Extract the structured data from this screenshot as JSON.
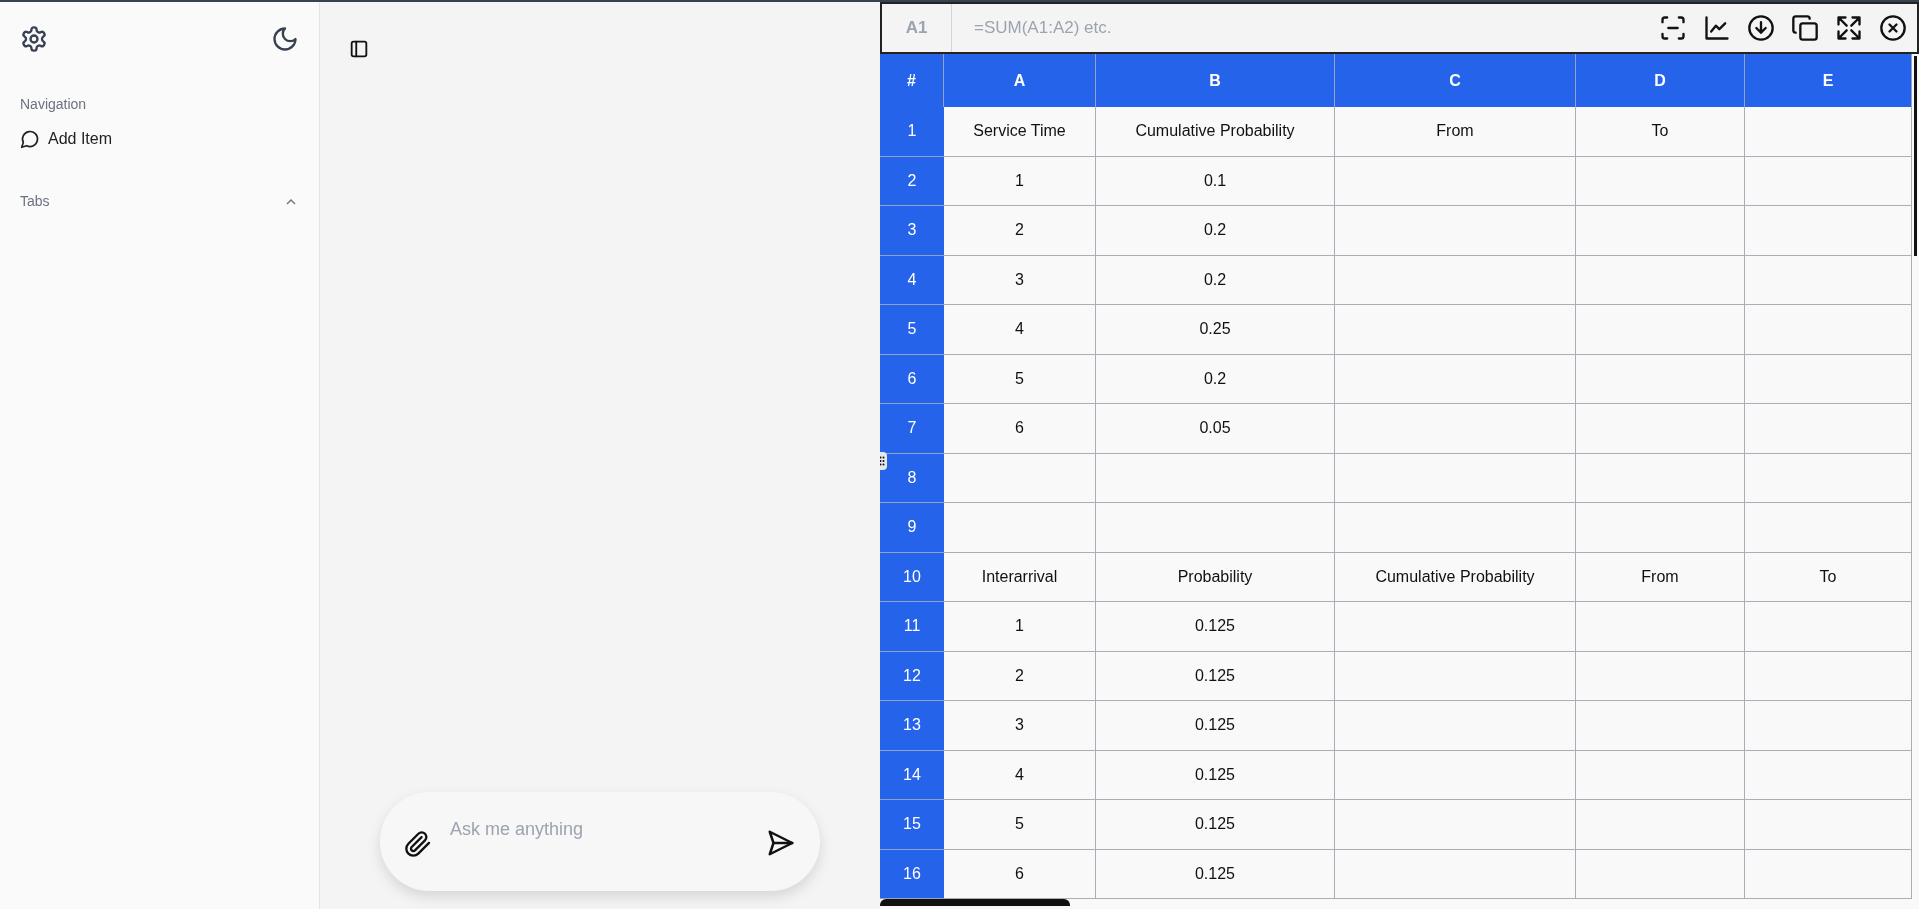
{
  "sidebar": {
    "navigation_heading": "Navigation",
    "items": [
      {
        "label": "Add Item"
      }
    ],
    "tabs_section": {
      "label": "Tabs",
      "expanded": true
    }
  },
  "chat": {
    "placeholder": "Ask me anything"
  },
  "spreadsheet": {
    "cell_reference": "A1",
    "formula_placeholder": "=SUM(A1:A2) etc.",
    "corner": "#",
    "columns": [
      "A",
      "B",
      "C",
      "D",
      "E"
    ],
    "rows": [
      {
        "number": "1",
        "cells": [
          "Service Time",
          "Cumulative Probability",
          "From",
          "To",
          null
        ]
      },
      {
        "number": "2",
        "cells": [
          "1",
          "0.1",
          null,
          null,
          null
        ]
      },
      {
        "number": "3",
        "cells": [
          "2",
          "0.2",
          null,
          null,
          null
        ]
      },
      {
        "number": "4",
        "cells": [
          "3",
          "0.2",
          null,
          null,
          null
        ]
      },
      {
        "number": "5",
        "cells": [
          "4",
          "0.25",
          null,
          null,
          null
        ]
      },
      {
        "number": "6",
        "cells": [
          "5",
          "0.2",
          null,
          null,
          null
        ]
      },
      {
        "number": "7",
        "cells": [
          "6",
          "0.05",
          null,
          null,
          null
        ]
      },
      {
        "number": "8",
        "cells": [
          null,
          null,
          null,
          null,
          null
        ]
      },
      {
        "number": "9",
        "cells": [
          null,
          null,
          null,
          null,
          null
        ]
      },
      {
        "number": "10",
        "cells": [
          "Interarrival",
          "Probability",
          "Cumulative Probability",
          "From",
          "To"
        ]
      },
      {
        "number": "11",
        "cells": [
          "1",
          "0.125",
          null,
          null,
          null
        ]
      },
      {
        "number": "12",
        "cells": [
          "2",
          "0.125",
          null,
          null,
          null
        ]
      },
      {
        "number": "13",
        "cells": [
          "3",
          "0.125",
          null,
          null,
          null
        ]
      },
      {
        "number": "14",
        "cells": [
          "4",
          "0.125",
          null,
          null,
          null
        ]
      },
      {
        "number": "15",
        "cells": [
          "5",
          "0.125",
          null,
          null,
          null
        ]
      },
      {
        "number": "16",
        "cells": [
          "6",
          "0.125",
          null,
          null,
          null
        ]
      }
    ]
  }
}
